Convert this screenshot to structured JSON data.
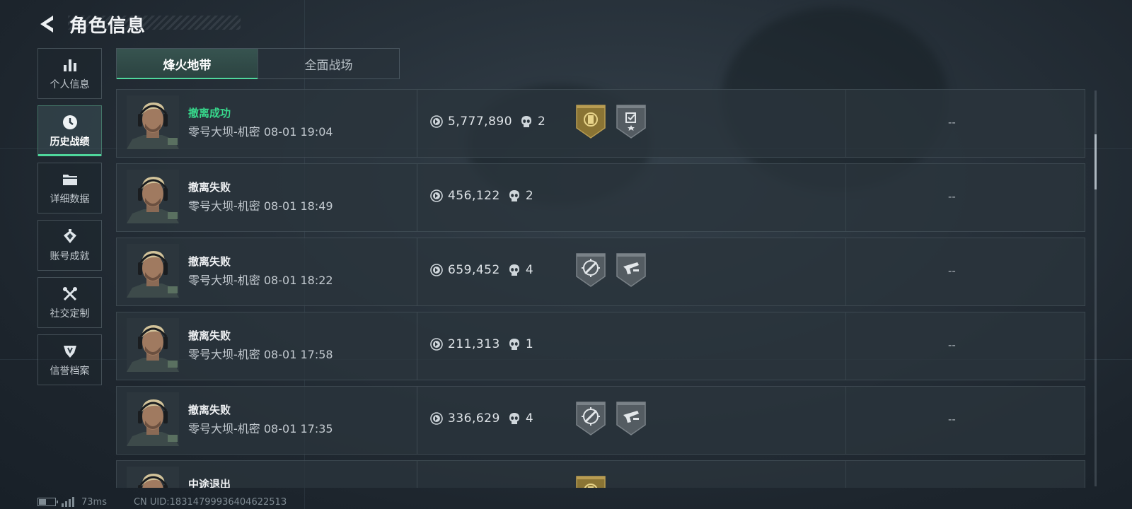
{
  "header": {
    "title": "角色信息"
  },
  "sidebar": {
    "items": [
      {
        "label": "个人信息",
        "icon": "bar-chart-icon",
        "active": false
      },
      {
        "label": "历史战绩",
        "icon": "clock-icon",
        "active": true
      },
      {
        "label": "详细数据",
        "icon": "folder-icon",
        "active": false
      },
      {
        "label": "账号成就",
        "icon": "achievement-icon",
        "active": false
      },
      {
        "label": "社交定制",
        "icon": "tools-icon",
        "active": false
      },
      {
        "label": "信誉档案",
        "icon": "shield-emblem-icon",
        "active": false
      }
    ]
  },
  "tabs": [
    {
      "label": "烽火地带",
      "active": true
    },
    {
      "label": "全面战场",
      "active": false
    }
  ],
  "matches": [
    {
      "status": "撤离成功",
      "success": true,
      "map": "零号大坝-机密",
      "time": "08-01 19:04",
      "value": "5,777,890",
      "kills": "2",
      "badges": [
        "gold-emblem-badge",
        "checklist-star-badge"
      ],
      "extra": "--"
    },
    {
      "status": "撤离失败",
      "success": false,
      "map": "零号大坝-机密",
      "time": "08-01 18:49",
      "value": "456,122",
      "kills": "2",
      "badges": [],
      "extra": "--"
    },
    {
      "status": "撤离失败",
      "success": false,
      "map": "零号大坝-机密",
      "time": "08-01 18:22",
      "value": "659,452",
      "kills": "4",
      "badges": [
        "crosshair-badge",
        "gun-badge"
      ],
      "extra": "--"
    },
    {
      "status": "撤离失败",
      "success": false,
      "map": "零号大坝-机密",
      "time": "08-01 17:58",
      "value": "211,313",
      "kills": "1",
      "badges": [],
      "extra": "--"
    },
    {
      "status": "撤离失败",
      "success": false,
      "map": "零号大坝-机密",
      "time": "08-01 17:35",
      "value": "336,629",
      "kills": "4",
      "badges": [
        "crosshair-badge",
        "gun-badge"
      ],
      "extra": "--"
    },
    {
      "status": "中途退出",
      "success": false,
      "map": "",
      "time": "",
      "value": "",
      "kills": "",
      "badges": [
        "gold-emblem-badge"
      ],
      "extra": ""
    }
  ],
  "footer": {
    "ping": "73ms",
    "uid": "CN UID:1831479993640462251З"
  },
  "colors": {
    "accent": "#4fd79c",
    "success_text": "#37d98c",
    "gold_badge": "#8a7434",
    "grey_badge": "#545c62"
  }
}
